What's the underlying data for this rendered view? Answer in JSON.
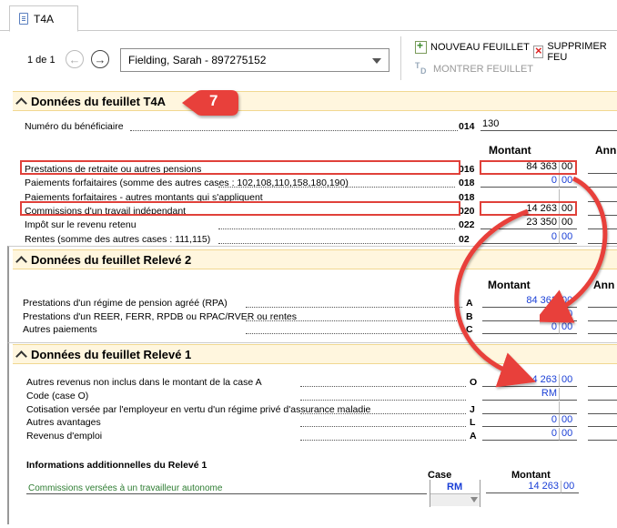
{
  "tab": {
    "label": "T4A",
    "icon": "document-icon"
  },
  "toolbar": {
    "pager": "1 de 1",
    "selected_slip": "Fielding, Sarah - 897275152",
    "new_sheet": "NOUVEAU FEUILLET",
    "delete_sheet": "SUPPRIMER FEU",
    "show_sheet": "MONTRER FEUILLET"
  },
  "badge_number": "7",
  "t4a": {
    "title": "Données du feuillet T4A",
    "beneficiary_label": "Numéro du bénéficiaire",
    "beneficiary_code": "014",
    "beneficiary_value": "130",
    "amount_header": "Montant",
    "year_header": "Ann",
    "rows": [
      {
        "label": "Prestations de retraite ou autres pensions",
        "code": "016",
        "amount": "84 363",
        "cents": "00"
      },
      {
        "label": "Paiements forfaitaires (somme des autres cases : 102,108,110,158,180,190)",
        "code": "018",
        "amount": "0",
        "cents": "00"
      },
      {
        "label": "Paiements forfaitaires - autres montants qui s'appliquent",
        "code": "018",
        "amount": "",
        "cents": ""
      },
      {
        "label": "Commissions d'un travail indépendant",
        "code": "020",
        "amount": "14 263",
        "cents": "00"
      },
      {
        "label": "Impôt sur le revenu retenu",
        "code": "022",
        "amount": "23 350",
        "cents": "00"
      },
      {
        "label": "Rentes (somme des autres cases : 111,115)",
        "code": "02",
        "amount": "0",
        "cents": "00"
      }
    ]
  },
  "releve2": {
    "title": "Données du feuillet Relevé 2",
    "amount_header": "Montant",
    "year_header": "Ann",
    "rows": [
      {
        "label": "Prestations d'un régime de pension agréé (RPA)",
        "code": "A",
        "amount": "84 363",
        "cents": "00"
      },
      {
        "label": "Prestations d'un REER, FERR, RPDB ou RPAC/RVER ou rentes",
        "code": "B",
        "amount": "",
        "cents": "00"
      },
      {
        "label": "Autres paiements",
        "code": "C",
        "amount": "0",
        "cents": "00"
      }
    ]
  },
  "releve1": {
    "title": "Données du feuillet Relevé 1",
    "rows": [
      {
        "label": "Autres revenus non inclus dans le montant de la case A",
        "code": "O",
        "amount": "14 263",
        "cents": "00"
      },
      {
        "label": "Code (case O)",
        "code": "",
        "amount": "RM",
        "cents": ""
      },
      {
        "label": "Cotisation versée par l'employeur en vertu d'un régime privé d'assurance maladie",
        "code": "J",
        "amount": "",
        "cents": ""
      },
      {
        "label": "Autres avantages",
        "code": "L",
        "amount": "0",
        "cents": "00"
      },
      {
        "label": "Revenus d'emploi",
        "code": "A",
        "amount": "0",
        "cents": "00"
      }
    ],
    "additional": {
      "title": "Informations additionnelles du Relevé 1",
      "case_header": "Case",
      "amount_header": "Montant",
      "row_label": "Commissions versées à un travailleur autonome",
      "row_case": "RM",
      "row_amount": "14 263",
      "row_cents": "00"
    }
  },
  "colors": {
    "highlight": "#e0413a",
    "section_bg": "#fff6de",
    "amount_blue": "#1a3fd6",
    "green_label": "#2e7d32"
  }
}
